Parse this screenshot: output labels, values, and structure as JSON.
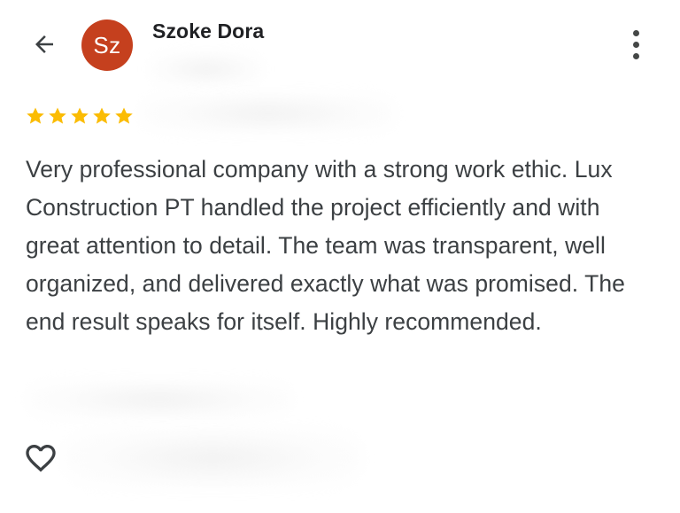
{
  "header": {
    "back_icon": "arrow-left-icon",
    "more_icon": "more-vertical-icon"
  },
  "reviewer": {
    "initials": "Sz",
    "name": "Szoke Dora",
    "avatar_color": "#c5401e"
  },
  "review": {
    "rating": 5,
    "max_rating": 5,
    "star_color": "#fbbc04",
    "text": "Very professional company with a strong work ethic. Lux Construction PT handled the project efficiently and with great attention to detail. The team was transparent, well organized, and delivered exactly what was promised. The end result speaks for itself. Highly recommended."
  },
  "actions": {
    "like_icon": "heart-outline-icon"
  }
}
